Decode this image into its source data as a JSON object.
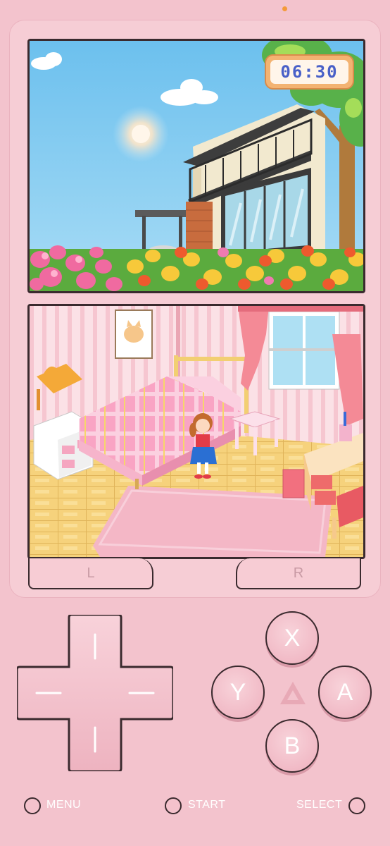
{
  "top_screen": {
    "clock": "06:30",
    "scene": "house-exterior-with-tulips"
  },
  "bottom_screen": {
    "scene": "pink-bedroom-with-girl"
  },
  "shoulder_buttons": {
    "left": "L",
    "right": "R"
  },
  "face_buttons": {
    "x": "X",
    "y": "Y",
    "a": "A",
    "b": "B"
  },
  "menu": {
    "menu_label": "MENU",
    "start_label": "START",
    "select_label": "SELECT"
  },
  "colors": {
    "body": "#f3c3cd",
    "shell": "#f6cdd5",
    "outline": "#3a2a2e",
    "clock_text": "#4960c8",
    "status_dot": "#f49a3a"
  }
}
